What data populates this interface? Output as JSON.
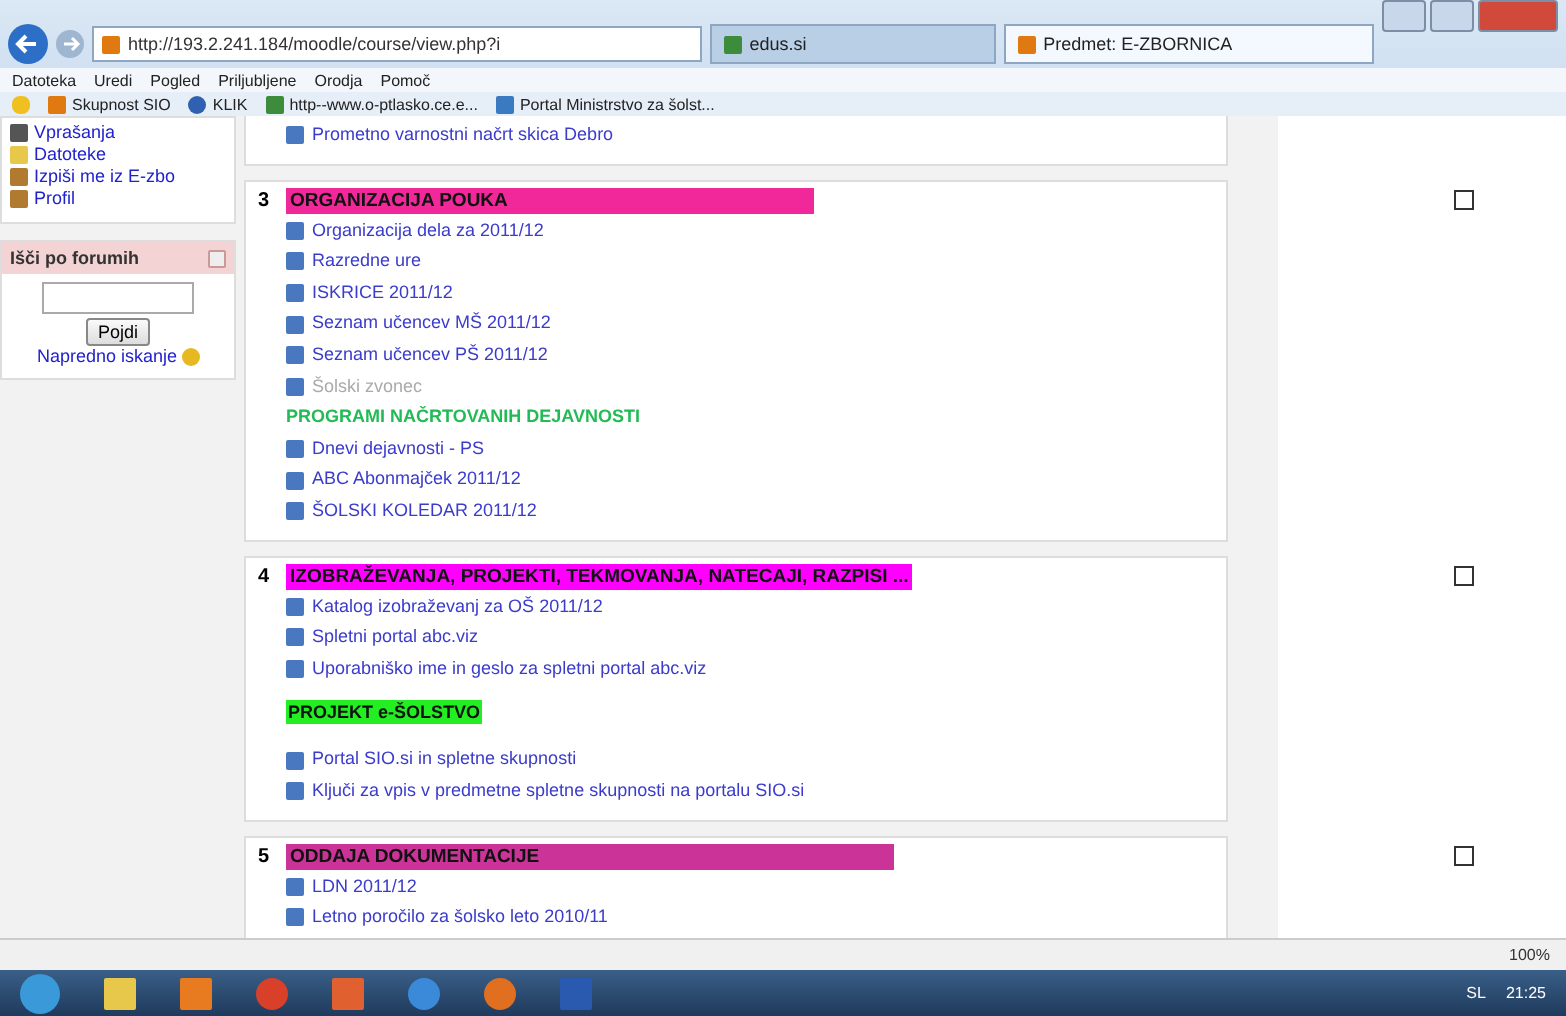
{
  "browser": {
    "url": "http://193.2.241.184/moodle/course/view.php?i",
    "tabs": [
      {
        "label": "edus.si",
        "selected": false
      },
      {
        "label": "Predmet: E-ZBORNICA",
        "selected": true
      }
    ],
    "menu": [
      "Datoteka",
      "Uredi",
      "Pogled",
      "Priljubljene",
      "Orodja",
      "Pomoč"
    ],
    "favorites": [
      "Skupnost SIO",
      "KLIK",
      "http--www.o-ptlasko.ce.e...",
      "Portal Ministrstvo za šolst..."
    ]
  },
  "sidebar": {
    "nav_items": [
      "Vprašanja",
      "Datoteke",
      "Izpiši me iz E-zbo",
      "Profil"
    ],
    "search_block": {
      "title": "Išči po forumih",
      "button": "Pojdi",
      "link": "Napredno iskanje"
    }
  },
  "sections": [
    {
      "items": [
        {
          "kind": "link",
          "label": "Prometno varnostni načrt skica Debro",
          "disabled": false
        }
      ]
    },
    {
      "number": "3",
      "title": "ORGANIZACIJA POUKA",
      "color": "#f0289a",
      "items": [
        {
          "kind": "link",
          "label": "Organizacija dela za 2011/12",
          "disabled": false
        },
        {
          "kind": "link",
          "label": "Razredne ure",
          "disabled": false
        },
        {
          "kind": "link",
          "label": "ISKRICE 2011/12",
          "disabled": false
        },
        {
          "kind": "link",
          "label": "Seznam učencev MŠ 2011/12",
          "disabled": false
        },
        {
          "kind": "link",
          "label": "Seznam učencev PŠ 2011/12",
          "disabled": false
        },
        {
          "kind": "link",
          "label": "Šolski zvonec",
          "disabled": true
        },
        {
          "kind": "heading",
          "label": "PROGRAMI NAČRTOVANIH DEJAVNOSTI"
        },
        {
          "kind": "link",
          "label": "Dnevi dejavnosti - PS",
          "disabled": false
        },
        {
          "kind": "link",
          "label": "ABC Abonmajček 2011/12",
          "disabled": false
        },
        {
          "kind": "link",
          "label": "ŠOLSKI KOLEDAR 2011/12",
          "disabled": false
        }
      ]
    },
    {
      "number": "4",
      "title": "IZOBRAŽEVANJA, PROJEKTI, TEKMOVANJA, NATECAJI, RAZPISI ...",
      "color": "#ff00ff",
      "items": [
        {
          "kind": "link",
          "label": "Katalog izobraževanj za OŠ 2011/12",
          "disabled": false
        },
        {
          "kind": "link",
          "label": "Spletni portal abc.viz",
          "disabled": false
        },
        {
          "kind": "link",
          "label": "Uporabniško ime in geslo za spletni portal abc.viz",
          "disabled": false
        },
        {
          "kind": "banner",
          "label": "PROJEKT e-ŠOLSTVO"
        },
        {
          "kind": "link",
          "label": "Portal SIO.si in spletne skupnosti",
          "disabled": false
        },
        {
          "kind": "link",
          "label": "Ključi za vpis v predmetne spletne skupnosti na portalu SIO.si",
          "disabled": false
        }
      ]
    },
    {
      "number": "5",
      "title": "ODDAJA DOKUMENTACIJE",
      "color": "#cc3399",
      "items": [
        {
          "kind": "link",
          "label": "LDN 2011/12",
          "disabled": false
        },
        {
          "kind": "link",
          "label": "Letno poročilo za šolsko leto 2010/11",
          "disabled": false
        }
      ]
    }
  ],
  "status_bar": {
    "zoom": "100%"
  },
  "taskbar": {
    "language": "SL",
    "time": "21:25"
  }
}
